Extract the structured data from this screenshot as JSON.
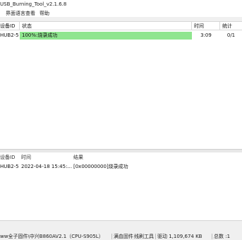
{
  "window": {
    "title": "USB_Burning_Tool_v2.1.6.8"
  },
  "menu": {
    "items": [
      "界面语言",
      "查看",
      "帮助"
    ]
  },
  "device_table": {
    "columns": [
      "设备ID",
      "状态",
      "时间",
      "统计"
    ],
    "rows": [
      {
        "device_id": "HUB2-5",
        "status": "100%:烧录成功",
        "progress_percent": 100,
        "time": "3:09",
        "count": "0/1"
      }
    ]
  },
  "log_table": {
    "columns": [
      "设备ID",
      "时间",
      "结果"
    ],
    "rows": [
      {
        "device_id": "HUB2-5",
        "time": "2022-04-18 15:45:...",
        "result": "[0x00000000]烧录成功"
      }
    ]
  },
  "statusbar": {
    "segments": [
      "ww全子固件\\中兴B860AV2.1（CPU-S905L）",
      "满血固件",
      "线刷工具",
      "驱动 1,109,674 KB",
      "总数 :1"
    ]
  },
  "colors": {
    "progress_fill": "#8fe58f"
  }
}
